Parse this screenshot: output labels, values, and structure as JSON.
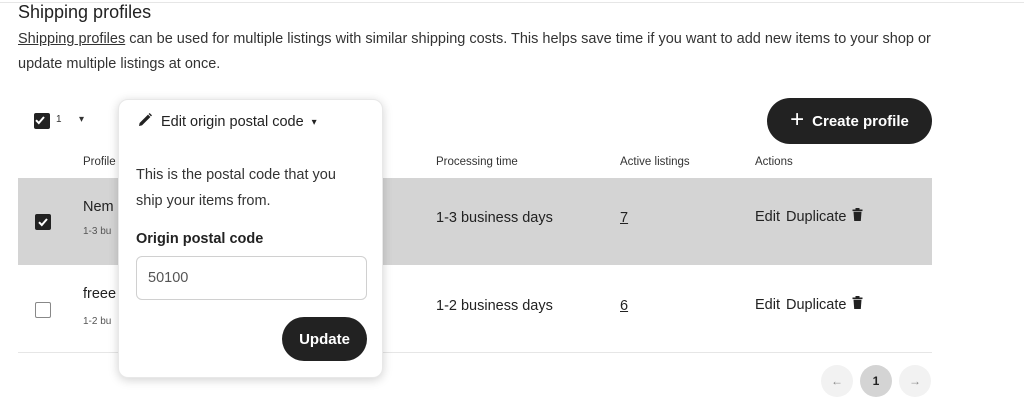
{
  "section": {
    "title": "Shipping profiles",
    "description_link": "Shipping profiles",
    "description_rest": " can be used for multiple listings with similar shipping costs. This helps save time if you want to add new items to your shop or update multiple listings at once."
  },
  "bulk": {
    "selected_count": "1",
    "caret": "▾"
  },
  "create_button": {
    "icon": "plus-icon",
    "label": "Create profile"
  },
  "table": {
    "headers": {
      "profile": "Profile",
      "processing": "Processing time",
      "active": "Active listings",
      "actions": "Actions"
    },
    "rows": [
      {
        "name": "Nem",
        "sub": "1-3 bu",
        "checked": true,
        "processing": "1-3 business days",
        "active_listings": "7",
        "edit": "Edit",
        "duplicate": "Duplicate",
        "delete_icon": "trash-icon"
      },
      {
        "name": "freee",
        "sub": "1-2 bu",
        "checked": false,
        "processing": "1-2 business days",
        "active_listings": "6",
        "edit": "Edit",
        "duplicate": "Duplicate",
        "delete_icon": "trash-icon"
      }
    ]
  },
  "pagination": {
    "prev": "←",
    "current": "1",
    "next": "→"
  },
  "popover": {
    "header_icon": "pencil-icon",
    "header": "Edit origin postal code",
    "caret": "▾",
    "text": "This is the postal code that you ship your items from.",
    "field_label": "Origin postal code",
    "field_value": "50100",
    "button": "Update"
  },
  "colors": {
    "primary": "#222222",
    "selected_row": "#d4d4d4"
  }
}
